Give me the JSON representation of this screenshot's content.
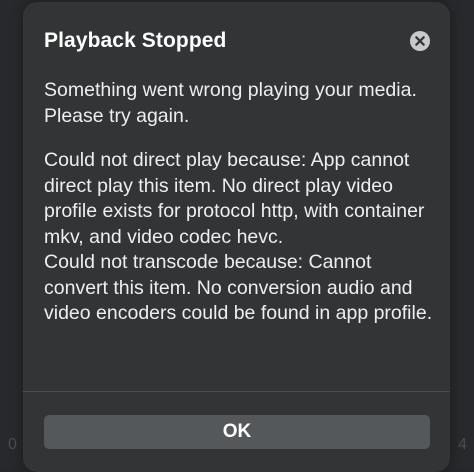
{
  "dialog": {
    "title": "Playback Stopped",
    "message": "Something went wrong playing your media. Please try again.",
    "details": [
      "Could not direct play because: App cannot direct play this item. No direct play video profile exists for protocol http, with container mkv, and video codec hevc.",
      "Could not transcode because: Cannot convert this item. No conversion audio and video encoders could be found in app profile."
    ],
    "ok_label": "OK",
    "close_icon": "close-circle-icon"
  },
  "background": {
    "left_char": "0",
    "right_char": "4"
  },
  "colors": {
    "dialog_bg": "#323436",
    "button_bg": "#55585b",
    "text": "#eeeeee",
    "close_icon_bg": "#c8c9cb"
  }
}
